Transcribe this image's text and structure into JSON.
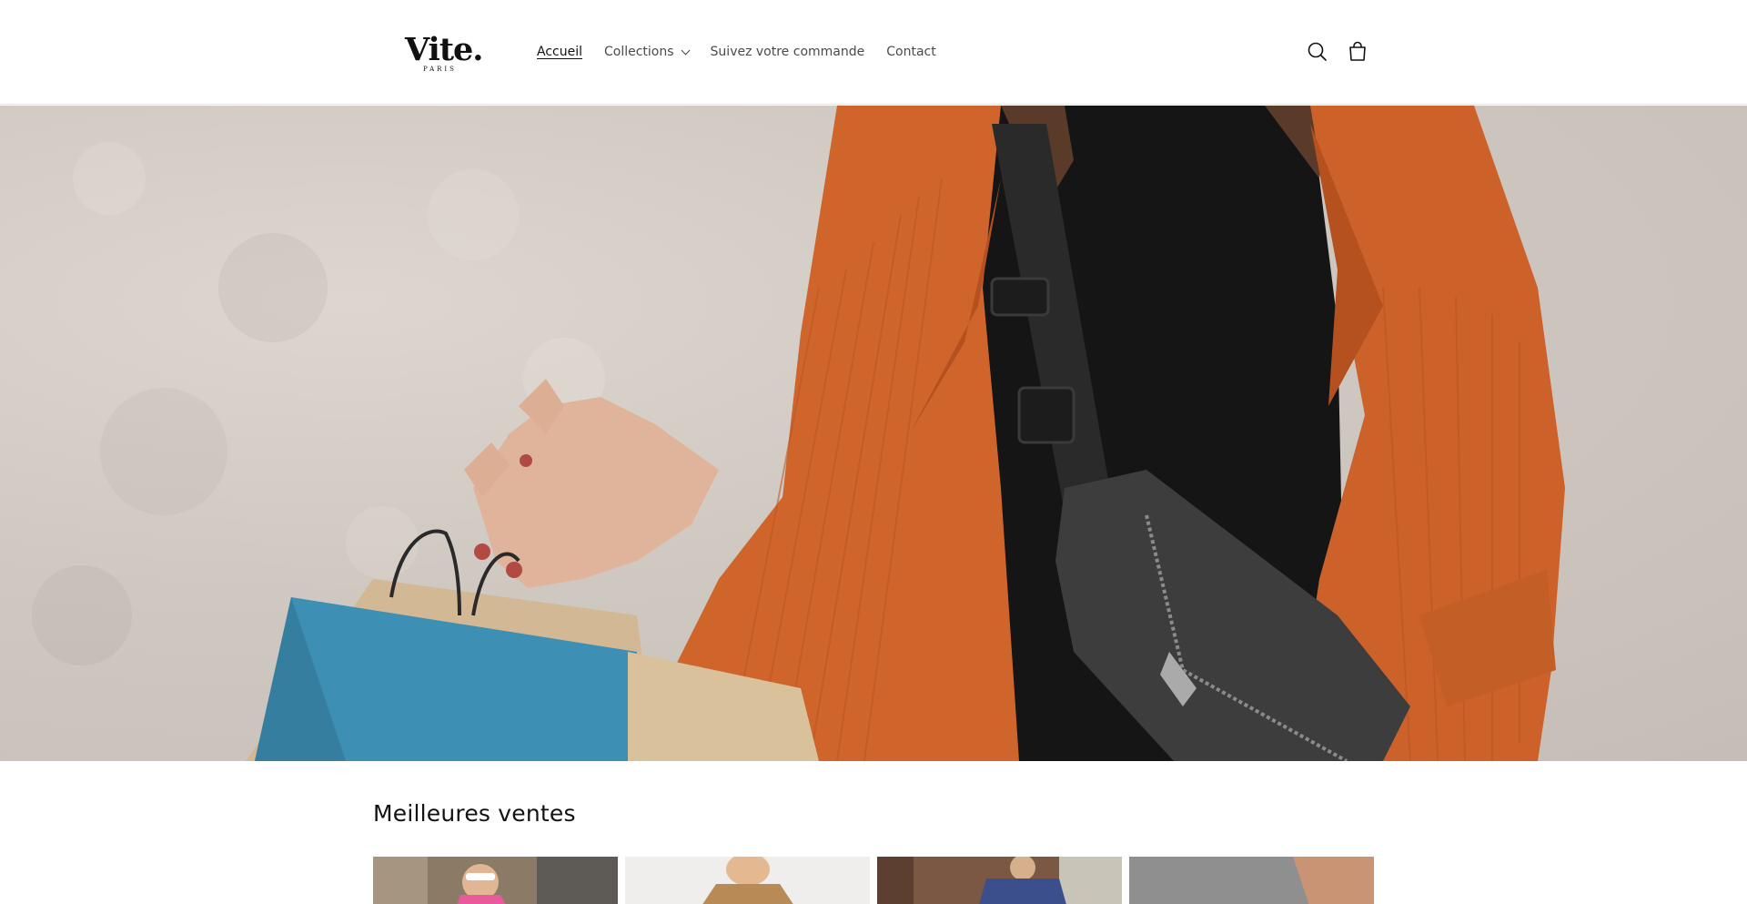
{
  "brand": {
    "logo_text": "Vite.",
    "logo_subtext": "PARIS"
  },
  "nav": {
    "items": [
      {
        "label": "Accueil",
        "active": true
      },
      {
        "label": "Collections",
        "has_dropdown": true
      },
      {
        "label": "Suivez votre commande"
      },
      {
        "label": "Contact"
      }
    ]
  },
  "header_icons": {
    "search": "search-icon",
    "cart": "cart-icon"
  },
  "hero": {
    "image": "woman-orange-jacket-shopping-bags"
  },
  "bestsellers": {
    "title": "Meilleures ventes",
    "products": [
      {
        "image": "woman-pink-outfit-sunglasses"
      },
      {
        "image": "woman-beige-top"
      },
      {
        "image": "woman-blue-floral-dress"
      },
      {
        "image": "product-grey-background"
      }
    ]
  },
  "colors": {
    "text": "#121212",
    "nav_text": "#4a4a4a",
    "accent_jacket": "#d0652c",
    "background": "#ffffff"
  }
}
